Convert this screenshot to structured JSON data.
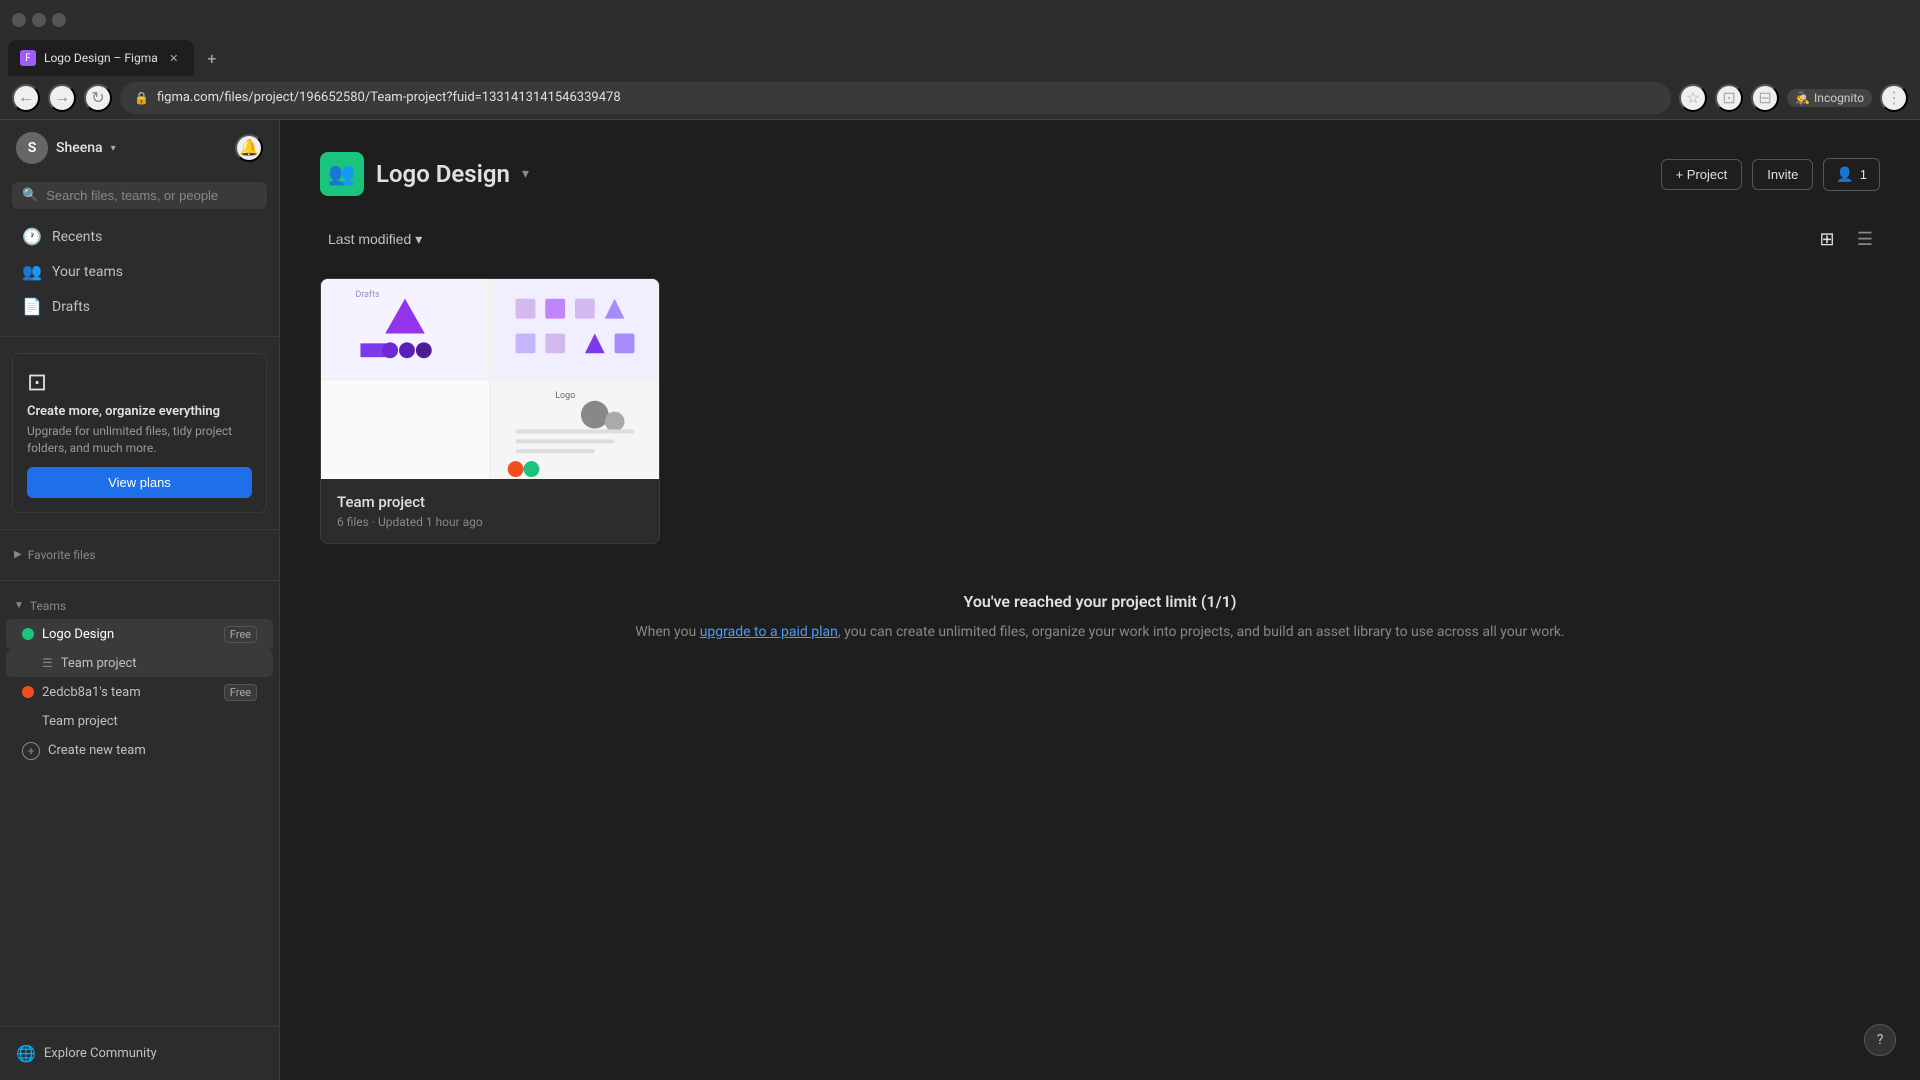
{
  "browser": {
    "tab_title": "Logo Design – Figma",
    "url": "figma.com/files/project/196652580/Team-project?fuid=1331413141546339478",
    "new_tab_label": "+",
    "nav_back": "←",
    "nav_forward": "→",
    "nav_reload": "↻",
    "incognito_label": "Incognito"
  },
  "sidebar": {
    "user_name": "Sheena",
    "user_initial": "S",
    "search_placeholder": "Search files, teams, or people",
    "nav_items": [
      {
        "id": "recents",
        "label": "Recents",
        "icon": "🕐"
      },
      {
        "id": "your-teams",
        "label": "Your teams",
        "icon": "👥"
      },
      {
        "id": "drafts",
        "label": "Drafts",
        "icon": "📄"
      }
    ],
    "upgrade": {
      "icon": "⊡",
      "title": "Create more, organize everything",
      "description": "Upgrade for unlimited files, tidy project folders, and much more.",
      "button_label": "View plans"
    },
    "favorite_files_label": "Favorite files",
    "teams_label": "Teams",
    "teams": [
      {
        "id": "logo-design",
        "label": "Logo Design",
        "badge": "Free",
        "color": "green",
        "active": true,
        "sub_items": [
          {
            "id": "team-project",
            "label": "Team project",
            "active": true
          }
        ]
      },
      {
        "id": "2edcb8a1",
        "label": "2edcb8a1's team",
        "badge": "Free",
        "color": "red",
        "active": false,
        "sub_items": [
          {
            "id": "team-project-2",
            "label": "Team project",
            "active": false
          }
        ]
      }
    ],
    "create_team_label": "Create new team",
    "explore_label": "Explore Community"
  },
  "main": {
    "team_name": "Logo Design",
    "add_project_label": "+ Project",
    "invite_label": "Invite",
    "members_label": "1",
    "filter_label": "Last modified",
    "project": {
      "name": "Team project",
      "files_count": "6 files",
      "updated": "Updated 1 hour ago"
    },
    "limit": {
      "title": "You've reached your project limit (1/1)",
      "desc_before": "When you ",
      "link_text": "upgrade to a paid plan",
      "desc_after": ", you can create unlimited files, organize your work into projects, and build an asset library to use across all your work."
    }
  }
}
